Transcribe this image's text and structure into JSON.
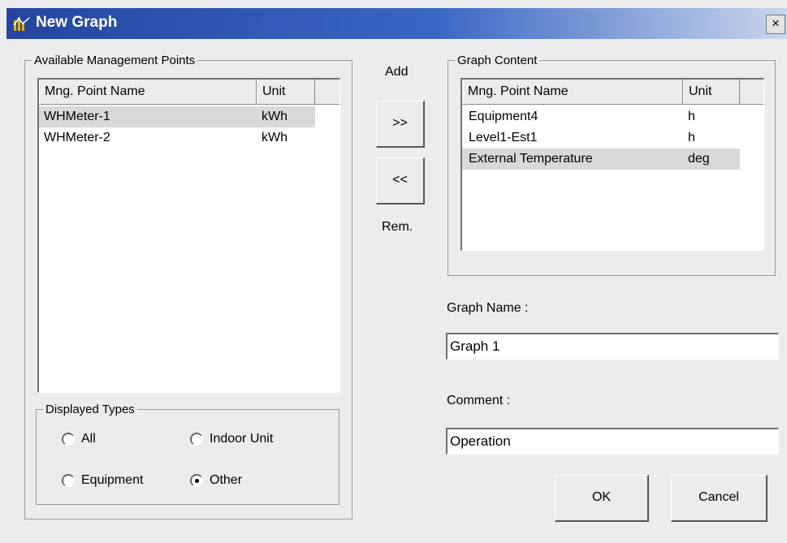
{
  "window": {
    "title": "New Graph",
    "close_label": "×"
  },
  "available": {
    "legend": "Available Management Points",
    "columns": [
      "Mng. Point Name",
      "Unit"
    ],
    "rows": [
      {
        "name": "WHMeter-1",
        "unit": "kWh"
      },
      {
        "name": "WHMeter-2",
        "unit": "kWh"
      }
    ]
  },
  "transfer": {
    "add_label": "Add",
    "add_button": ">>",
    "remove_button": "<<",
    "remove_label": "Rem."
  },
  "graph_content": {
    "legend": "Graph Content",
    "columns": [
      "Mng. Point Name",
      "Unit"
    ],
    "rows": [
      {
        "name": "Equipment4",
        "unit": "h"
      },
      {
        "name": "Level1-Est1",
        "unit": "h"
      },
      {
        "name": "External Temperature",
        "unit": "deg"
      }
    ]
  },
  "graph_name": {
    "label": "Graph Name :",
    "value": "Graph 1"
  },
  "comment": {
    "label": "Comment :",
    "value": "Operation"
  },
  "displayed_types": {
    "legend": "Displayed Types",
    "options": [
      "All",
      "Indoor Unit",
      "Equipment",
      "Other"
    ],
    "selected": "Other"
  },
  "buttons": {
    "ok": "OK",
    "cancel": "Cancel"
  },
  "colors": {
    "title_gradient_start": "#2445a0",
    "title_gradient_end": "#c9d6ec",
    "selection": "#d9d9d9"
  }
}
